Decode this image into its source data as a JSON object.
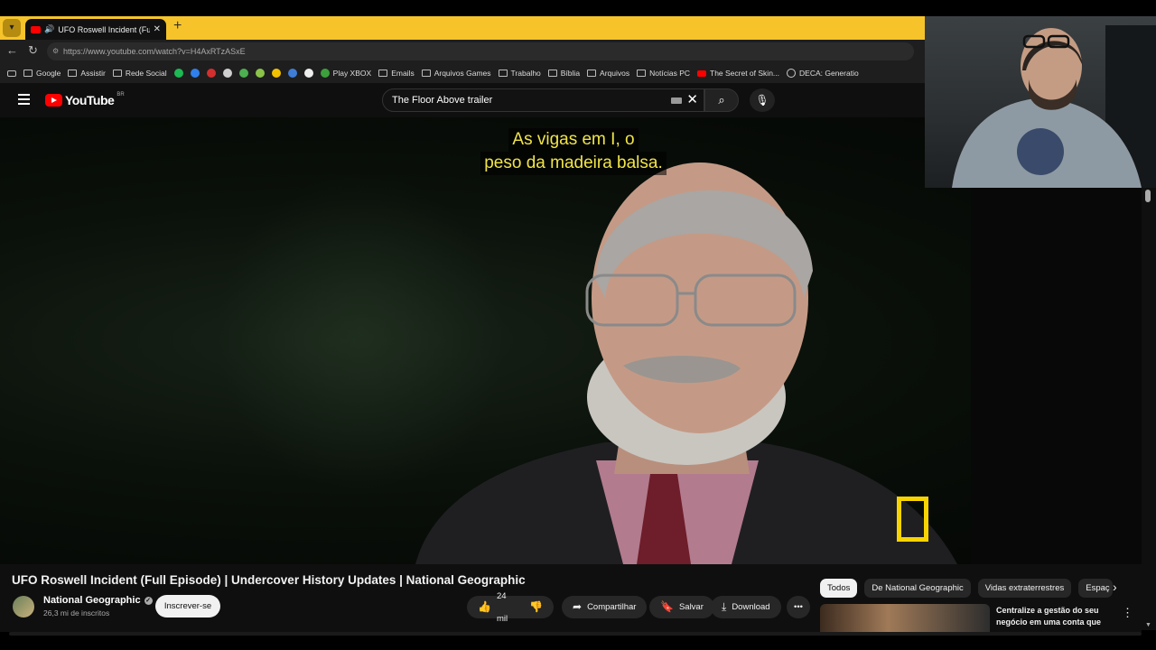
{
  "browser": {
    "tab_title": "UFO Roswell Incident (Full Ep",
    "new_tab": "+",
    "url_domain": "https://www.youtube.com",
    "url_path": "/watch?v=H4AxRTzASxE",
    "bookmarks": [
      {
        "label": "Google",
        "icon": "folder-icon"
      },
      {
        "label": "Assistir",
        "icon": "folder-icon"
      },
      {
        "label": "Rede Social",
        "icon": "folder-icon"
      },
      {
        "label": "",
        "icon": "green-circle-icon",
        "color": "#1db954"
      },
      {
        "label": "",
        "icon": "blue-circle-icon",
        "color": "#2f80ed"
      },
      {
        "label": "",
        "icon": "red-circle-icon",
        "color": "#d32f2f"
      },
      {
        "label": "",
        "icon": "grey-square-icon",
        "color": "#cfcfcf"
      },
      {
        "label": "",
        "icon": "multicolor-icon",
        "color": "#4caf50"
      },
      {
        "label": "",
        "icon": "green-figure-icon",
        "color": "#8bc34a"
      },
      {
        "label": "",
        "icon": "yellow-box-icon",
        "color": "#f2c200"
      },
      {
        "label": "",
        "icon": "blue-brush-icon",
        "color": "#3f7dd8"
      },
      {
        "label": "",
        "icon": "s-icon",
        "color": "#eeeeee"
      },
      {
        "label": "Play XBOX",
        "icon": "xbox-icon"
      },
      {
        "label": "Emails",
        "icon": "folder-icon"
      },
      {
        "label": "Arquivos Games",
        "icon": "folder-icon"
      },
      {
        "label": "Trabalho",
        "icon": "folder-icon"
      },
      {
        "label": "Bíblia",
        "icon": "folder-icon"
      },
      {
        "label": "Arquivos",
        "icon": "folder-icon"
      },
      {
        "label": "Notícias PC",
        "icon": "folder-icon"
      },
      {
        "label": "The Secret of Skin...",
        "icon": "youtube-icon"
      },
      {
        "label": "DECA: Generatio",
        "icon": "globe-icon"
      }
    ]
  },
  "youtube": {
    "logo_text": "YouTube",
    "logo_region": "BR",
    "search_query": "The Floor Above trailer",
    "video": {
      "caption_line1": "As vigas em I, o",
      "caption_line2": "peso da madeira balsa.",
      "title": "UFO Roswell Incident (Full Episode) | Undercover History Updates | National Geographic"
    },
    "channel": {
      "name": "National Geographic",
      "subscribers": "26,3 mi de inscritos",
      "subscribe_label": "Inscrever-se"
    },
    "actions": {
      "likes": "24 mil",
      "share": "Compartilhar",
      "save": "Salvar",
      "download": "Download"
    },
    "chips": [
      "Todos",
      "De National Geographic",
      "Vidas extraterrestres",
      "Espaç"
    ],
    "recommendation": {
      "text": "Centralize a gestão do seu negócio em uma conta que ..."
    }
  },
  "colors": {
    "tabbar": "#f6c42a",
    "caption": "#f0e44a",
    "natgeo": "#f7d400",
    "youtube_red": "#ff0000"
  }
}
